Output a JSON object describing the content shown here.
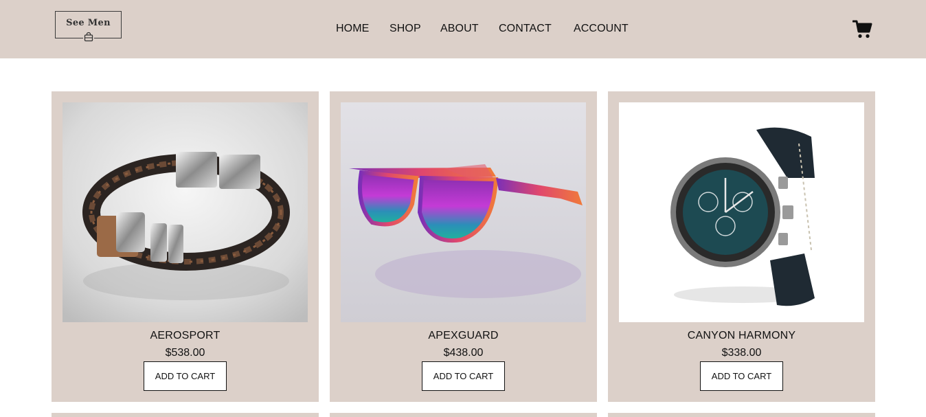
{
  "brand": {
    "name": "See Men"
  },
  "nav": {
    "items": [
      {
        "label": "HOME"
      },
      {
        "label": "SHOP"
      },
      {
        "label": "ABOUT"
      },
      {
        "label": "CONTACT"
      },
      {
        "label": "ACCOUNT"
      }
    ]
  },
  "cart": {
    "icon": "cart-icon"
  },
  "products": [
    {
      "name": "AEROSPORT",
      "price": "$538.00",
      "button": "ADD TO CART",
      "image": "braided-leather-bracelet"
    },
    {
      "name": "APEXGUARD",
      "price": "$438.00",
      "button": "ADD TO CART",
      "image": "mirrored-sunglasses"
    },
    {
      "name": "CANYON HARMONY",
      "price": "$338.00",
      "button": "ADD TO CART",
      "image": "chronograph-watch"
    }
  ],
  "colors": {
    "header_bg": "#dcd0c9",
    "card_bg": "#dcd0c9",
    "text": "#111111"
  }
}
